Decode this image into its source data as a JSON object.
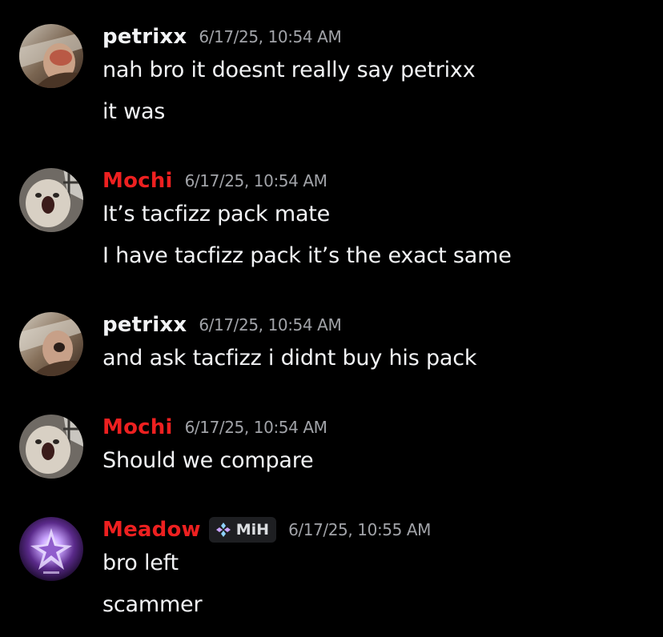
{
  "colors": {
    "background": "#000000",
    "username_default": "#f2f3f5",
    "username_role_red": "#ed2020",
    "timestamp": "#a1a3a8",
    "message_text": "#f2f3f5",
    "tag_bg": "#1e1f22"
  },
  "messages": [
    {
      "username": "petrixx",
      "timestamp": "6/17/25, 10:54 AM",
      "lines": [
        "nah bro it doesnt really say petrixx",
        "it was"
      ]
    },
    {
      "username": "Mochi",
      "timestamp": "6/17/25, 10:54 AM",
      "lines": [
        "It’s tacfizz pack mate",
        "I have tacfizz pack it’s the exact same"
      ]
    },
    {
      "username": "petrixx",
      "timestamp": "6/17/25, 10:54 AM",
      "lines": [
        "and ask tacfizz i didnt buy his pack"
      ]
    },
    {
      "username": "Mochi",
      "timestamp": "6/17/25, 10:54 AM",
      "lines": [
        "Should we compare"
      ]
    },
    {
      "username": "Meadow",
      "tag": {
        "icon": "diamond-cluster-icon",
        "label": "MiH"
      },
      "timestamp": "6/17/25, 10:55 AM",
      "lines": [
        "bro left",
        "scammer"
      ]
    }
  ]
}
